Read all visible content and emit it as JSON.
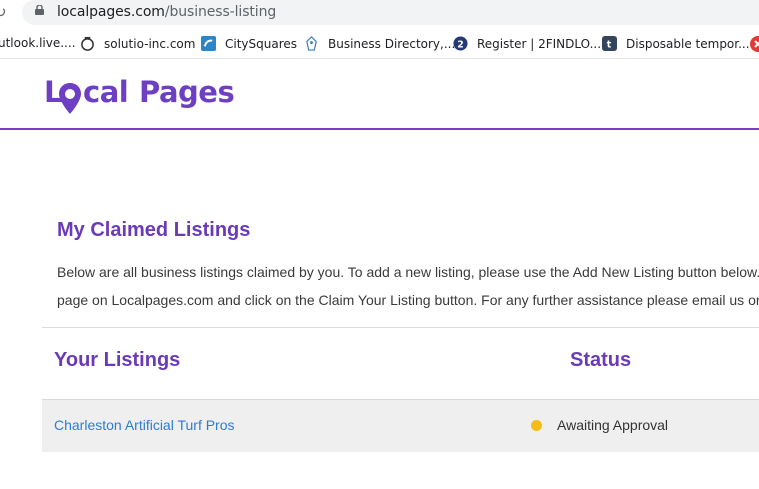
{
  "browser": {
    "url_host": "localpages.com",
    "url_path": "/business-listing",
    "bookmarks": [
      {
        "label": "utlook.live....",
        "icon": "outlook-icon"
      },
      {
        "label": "solutio-inc.com",
        "icon": "circle-icon"
      },
      {
        "label": "CitySquares",
        "icon": "citysquares-icon"
      },
      {
        "label": "Business Directory,...",
        "icon": "directory-icon"
      },
      {
        "label": "Register | 2FINDLO...",
        "icon": "2findlocal-icon"
      },
      {
        "label": "Disposable tempor...",
        "icon": "tumblr-icon"
      }
    ]
  },
  "site": {
    "logo_left": "L",
    "logo_mid": "cal",
    "logo_right": "Pages",
    "brand_color": "#6c3fc3"
  },
  "main": {
    "title": "My Claimed Listings",
    "description_line1": "Below are all business listings claimed by you. To add a new listing, please use the Add New Listing button below.",
    "description_line2": "page on Localpages.com and click on the Claim Your Listing button. For any further assistance please email us or",
    "col_listings": "Your Listings",
    "col_status": "Status",
    "listings": [
      {
        "name": "Charleston Artificial Turf Pros",
        "status": "Awaiting Approval",
        "status_color": "#f5bd12"
      }
    ]
  }
}
